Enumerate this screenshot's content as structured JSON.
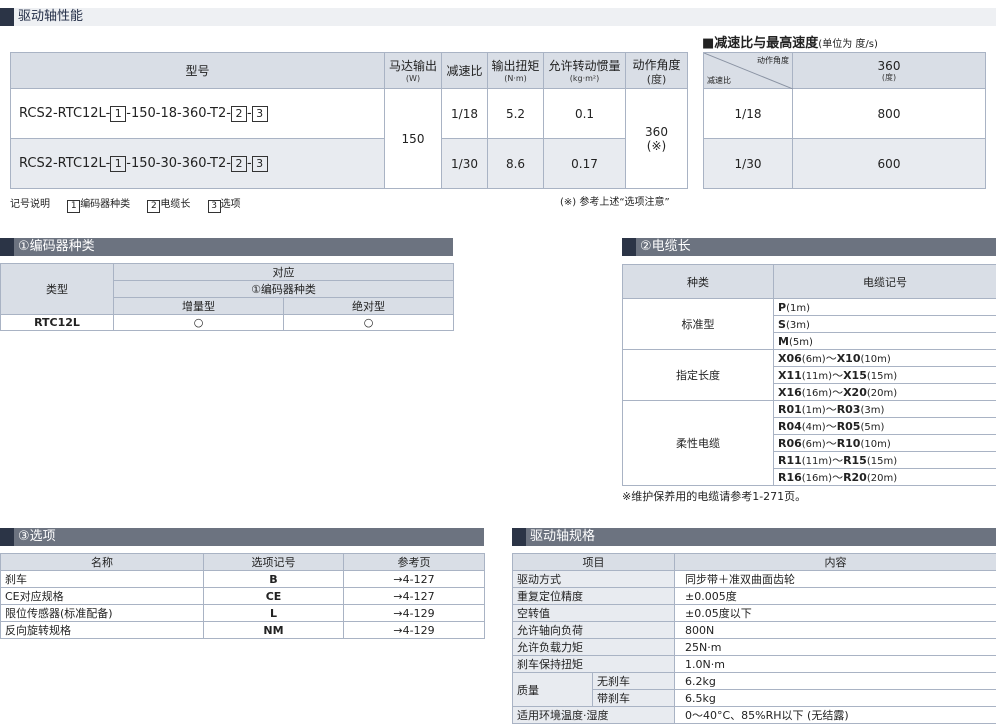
{
  "main": {
    "title": "驱动轴性能",
    "headers": {
      "model": "型号",
      "motor": "马达输出",
      "motor_unit": "(W)",
      "ratio": "减速比",
      "torque": "输出扭矩",
      "torque_unit": "(N·m)",
      "inertia": "允许转动惯量",
      "inertia_unit": "(kg·m²)",
      "angle": "动作角度",
      "angle_unit": "(度)"
    },
    "rows": [
      {
        "m_pre": "RCS2-RTC12L-",
        "m_n1": "1",
        "m_mid": "-150-18-360-T2-",
        "m_n2": "2",
        "m_sep": "-",
        "m_n3": "3",
        "ratio": "1/18",
        "torque": "5.2",
        "inertia": "0.1"
      },
      {
        "m_pre": "RCS2-RTC12L-",
        "m_n1": "1",
        "m_mid": "-150-30-360-T2-",
        "m_n2": "2",
        "m_sep": "-",
        "m_n3": "3",
        "ratio": "1/30",
        "torque": "8.6",
        "inertia": "0.17"
      }
    ],
    "motor_value": "150",
    "angle_value": "360",
    "angle_note": "(※)",
    "legend_label": "记号说明",
    "legend": [
      {
        "n": "1",
        "label": "编码器种类"
      },
      {
        "n": "2",
        "label": "电缆长"
      },
      {
        "n": "3",
        "label": "选项"
      }
    ],
    "note": "(※) 参考上述“选项注意”"
  },
  "speed": {
    "title": "■减速比与最高速度",
    "unit": "(单位为 度/s)",
    "diag_top": "动作角度",
    "diag_bottom": "减速比",
    "col": "360",
    "col_unit": "(度)",
    "rows": [
      {
        "ratio": "1/18",
        "speed": "800"
      },
      {
        "ratio": "1/30",
        "speed": "600"
      }
    ]
  },
  "encoder": {
    "title": "①编码器种类",
    "type_label": "类型",
    "corr": "对应",
    "corr_sub": "①编码器种类",
    "inc": "增量型",
    "abs": "绝对型",
    "row_label": "RTC12L",
    "mark": "○"
  },
  "cable": {
    "title": "②电缆长",
    "h_kind": "种类",
    "h_code": "电缆记号",
    "groups": [
      {
        "name": "标准型",
        "items": [
          {
            "c1": "P",
            "l1": "(1m)"
          },
          {
            "c1": "S",
            "l1": "(3m)"
          },
          {
            "c1": "M",
            "l1": "(5m)"
          }
        ]
      },
      {
        "name": "指定长度",
        "items": [
          {
            "c1": "X06",
            "l1": "(6m)",
            "c2": "X10",
            "l2": "(10m)"
          },
          {
            "c1": "X11",
            "l1": "(11m)",
            "c2": "X15",
            "l2": "(15m)"
          },
          {
            "c1": "X16",
            "l1": "(16m)",
            "c2": "X20",
            "l2": "(20m)"
          }
        ]
      },
      {
        "name": "柔性电缆",
        "items": [
          {
            "c1": "R01",
            "l1": "(1m)",
            "c2": "R03",
            "l2": "(3m)"
          },
          {
            "c1": "R04",
            "l1": "(4m)",
            "c2": "R05",
            "l2": "(5m)"
          },
          {
            "c1": "R06",
            "l1": "(6m)",
            "c2": "R10",
            "l2": "(10m)"
          },
          {
            "c1": "R11",
            "l1": "(11m)",
            "c2": "R15",
            "l2": "(15m)"
          },
          {
            "c1": "R16",
            "l1": "(16m)",
            "c2": "R20",
            "l2": "(20m)"
          }
        ]
      }
    ],
    "tilde": "～",
    "note": "※维护保养用的电缆请参考1-271页。"
  },
  "options": {
    "title": "③选项",
    "headers": [
      "名称",
      "选项记号",
      "参考页"
    ],
    "rows": [
      [
        "刹车",
        "B",
        "→4-127"
      ],
      [
        "CE对应规格",
        "CE",
        "→4-127"
      ],
      [
        "限位传感器(标准配备)",
        "L",
        "→4-129"
      ],
      [
        "反向旋转规格",
        "NM",
        "→4-129"
      ]
    ]
  },
  "spec": {
    "title": "驱动轴规格",
    "headers": [
      "项目",
      "内容"
    ],
    "rows": [
      [
        "驱动方式",
        "同步带＋准双曲面齿轮"
      ],
      [
        "重复定位精度",
        "±0.005度"
      ],
      [
        "空转值",
        "±0.05度以下"
      ],
      [
        "允许轴向负荷",
        "800N"
      ],
      [
        "允许负载力矩",
        "25N·m"
      ],
      [
        "刹车保持扭矩",
        "1.0N·m"
      ]
    ],
    "mass_label": "质量",
    "mass_rows": [
      [
        "无刹车",
        "6.2kg"
      ],
      [
        "带刹车",
        "6.5kg"
      ]
    ],
    "env": [
      "适用环境温度·湿度",
      "0～40°C、85%RH以下 (无结露)"
    ]
  }
}
